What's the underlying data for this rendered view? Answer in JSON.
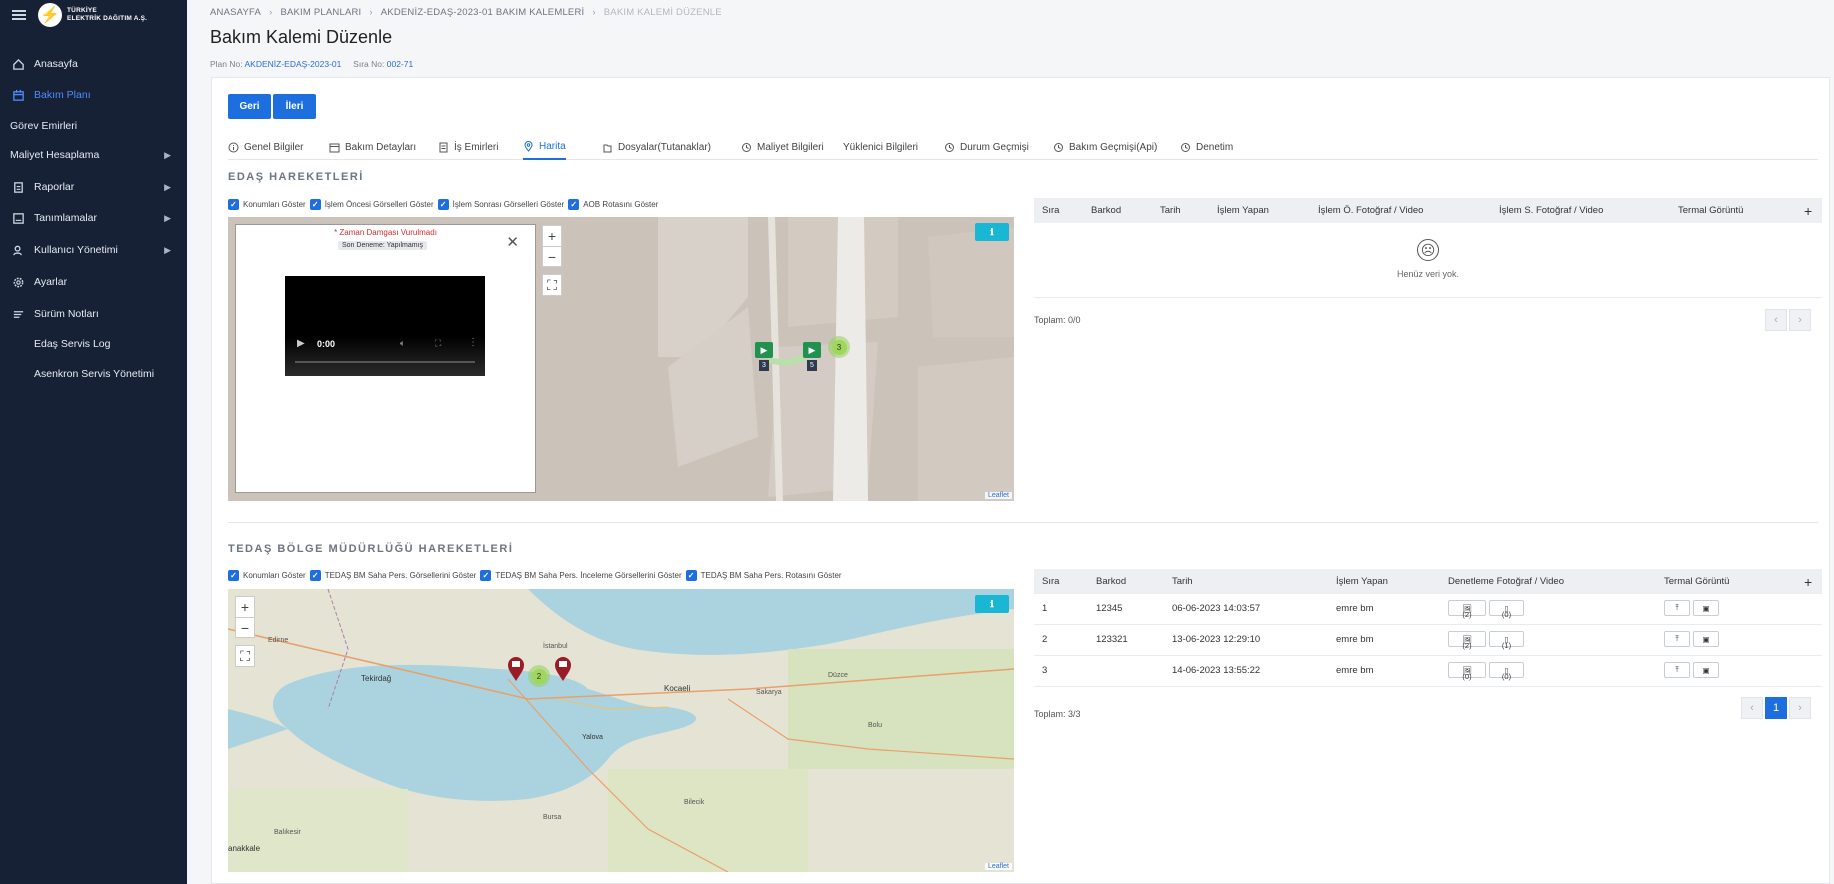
{
  "brand": {
    "line1": "TÜRKİYE",
    "line2": "ELEKTRİK DAĞITIM A.Ş."
  },
  "sidebar": {
    "items": [
      {
        "label": "Anasayfa",
        "icon": "home-icon"
      },
      {
        "label": "Bakım Planı",
        "icon": "calendar-icon",
        "active": true
      },
      {
        "label": "Görev Emirleri"
      },
      {
        "label": "Maliyet Hesaplama",
        "chevron": true
      },
      {
        "label": "Raporlar",
        "icon": "report-icon",
        "chevron": true
      },
      {
        "label": "Tanımlamalar",
        "icon": "list-icon",
        "chevron": true
      },
      {
        "label": "Kullanıcı Yönetimi",
        "icon": "users-icon",
        "chevron": true
      },
      {
        "label": "Ayarlar",
        "icon": "gear-icon"
      },
      {
        "label": "Sürüm Notları",
        "icon": "notes-icon"
      },
      {
        "label": "Edaş Servis Log"
      },
      {
        "label": "Asenkron Servis Yönetimi"
      }
    ]
  },
  "breadcrumb": [
    "ANASAYFA",
    "BAKIM PLANLARI",
    "AKDENİZ-EDAŞ-2023-01 BAKIM KALEMLERİ",
    "BAKIM KALEMİ DÜZENLE"
  ],
  "page": {
    "title": "Bakım Kalemi Düzenle",
    "plan_label": "Plan No:",
    "plan_value": "AKDENİZ-EDAŞ-2023-01",
    "sira_label": "Sıra No:",
    "sira_value": "002-71"
  },
  "buttons": {
    "back": "Geri",
    "next": "İleri"
  },
  "tabs": [
    "Genel Bilgiler",
    "Bakım Detayları",
    "İş Emirleri",
    "Harita",
    "Dosyalar(Tutanaklar)",
    "Maliyet Bilgileri",
    "Yüklenici Bilgileri",
    "Durum Geçmişi",
    "Bakım Geçmişi(Api)",
    "Denetim"
  ],
  "edas": {
    "title": "EDAŞ HAREKETLERİ",
    "checks": [
      "Konumları Göster",
      "İşlem Öncesi Görselleri Göster",
      "İşlem Sonrası Görselleri Göster",
      "AOB Rotasını Göster"
    ],
    "popup": {
      "warning": "Zaman Damgası Vurulmadı",
      "badge": "Son Deneme: Yapılmamış",
      "time": "0:00"
    },
    "markers": [
      "3",
      "5"
    ],
    "cluster": "3",
    "leaflet": "Leaflet",
    "table": {
      "headers": [
        "Sıra",
        "Barkod",
        "Tarih",
        "İşlem Yapan",
        "İşlem Ö. Fotoğraf / Video",
        "İşlem S. Fotoğraf / Video",
        "Termal Görüntü"
      ],
      "empty": "Henüz veri yok.",
      "total_label": "Toplam:",
      "total": "0/0"
    }
  },
  "tedas": {
    "title": "TEDAŞ BÖLGE MÜDÜRLÜĞÜ HAREKETLERİ",
    "checks": [
      "Konumları Göster",
      "TEDAŞ BM Saha Pers. Görsellerini Göster",
      "TEDAŞ BM Saha Pers. İnceleme Görsellerini Göster",
      "TEDAŞ BM Saha Pers. Rotasını Göster"
    ],
    "map_labels": [
      "Edirne",
      "Tekirdağ",
      "İstanbul",
      "Kocaeli",
      "Yalova",
      "Bursa",
      "Sakarya",
      "Düzce",
      "Bolu",
      "Bilecik",
      "anakkale",
      "Balıkesir"
    ],
    "cluster": "2",
    "leaflet": "Leaflet",
    "table": {
      "headers": [
        "Sıra",
        "Barkod",
        "Tarih",
        "İşlem Yapan",
        "Denetleme Fotoğraf / Video",
        "Termal Görüntü"
      ],
      "rows": [
        {
          "sira": "1",
          "barkod": "12345",
          "tarih": "06-06-2023 14:03:57",
          "islem": "emre bm",
          "img": "(2)",
          "doc": "(0)"
        },
        {
          "sira": "2",
          "barkod": "123321",
          "tarih": "13-06-2023 12:29:10",
          "islem": "emre bm",
          "img": "(2)",
          "doc": "(1)"
        },
        {
          "sira": "3",
          "barkod": "",
          "tarih": "14-06-2023 13:55:22",
          "islem": "emre bm",
          "img": "(0)",
          "doc": "(0)"
        }
      ],
      "total_label": "Toplam:",
      "total": "3/3",
      "page": "1"
    }
  }
}
